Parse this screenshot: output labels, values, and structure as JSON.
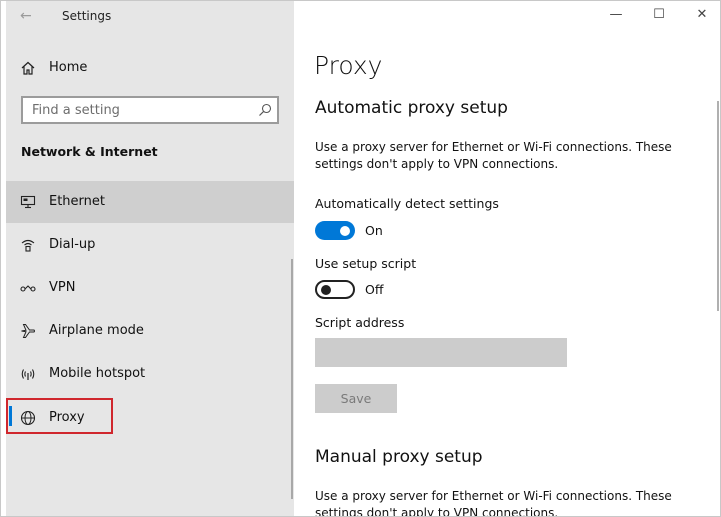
{
  "window": {
    "title": "Settings"
  },
  "sidebar": {
    "home_label": "Home",
    "search_placeholder": "Find a setting",
    "section_title": "Network & Internet",
    "items": [
      {
        "label": "Ethernet",
        "icon": "ethernet-icon"
      },
      {
        "label": "Dial-up",
        "icon": "dialup-icon"
      },
      {
        "label": "VPN",
        "icon": "vpn-icon"
      },
      {
        "label": "Airplane mode",
        "icon": "airplane-icon"
      },
      {
        "label": "Mobile hotspot",
        "icon": "hotspot-icon"
      },
      {
        "label": "Proxy",
        "icon": "globe-icon"
      }
    ]
  },
  "main": {
    "page_title": "Proxy",
    "auto": {
      "heading": "Automatic proxy setup",
      "description": "Use a proxy server for Ethernet or Wi-Fi connections. These settings don't apply to VPN connections.",
      "detect_label": "Automatically detect settings",
      "detect_state": "On",
      "script_label": "Use setup script",
      "script_state": "Off",
      "address_label": "Script address",
      "address_value": "",
      "save_label": "Save"
    },
    "manual": {
      "heading": "Manual proxy setup",
      "description": "Use a proxy server for Ethernet or Wi-Fi connections. These settings don't apply to VPN connections."
    }
  },
  "colors": {
    "accent": "#0078d7",
    "highlight": "#d0272d",
    "sidebar_bg": "#e6e6e6",
    "selected_bg": "#cfcfcf"
  }
}
